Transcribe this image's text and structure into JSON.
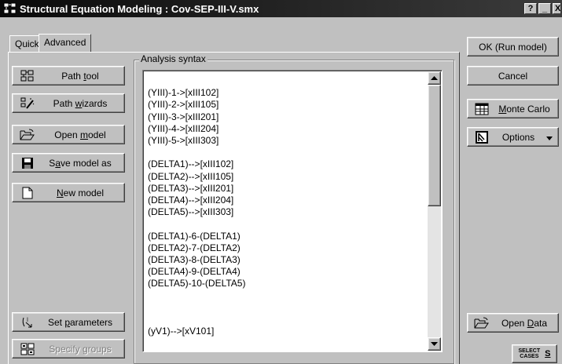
{
  "window": {
    "title": "Structural Equation Modeling : Cov-SEP-III-V.smx",
    "controls": [
      "?",
      "_",
      "X"
    ]
  },
  "tabs": [
    {
      "label": "Quick",
      "active": false
    },
    {
      "label": "Advanced",
      "active": true
    }
  ],
  "left_buttons": [
    {
      "pre": "Path ",
      "key": "t",
      "post": "ool",
      "icon": "path-tool-icon"
    },
    {
      "pre": "Path ",
      "key": "w",
      "post": "izards",
      "icon": "wand-icon"
    },
    {
      "pre": "Open ",
      "key": "m",
      "post": "odel",
      "icon": "open-folder-icon"
    },
    {
      "pre": "S",
      "key": "a",
      "post": "ve model as",
      "icon": "floppy-disk-icon"
    },
    {
      "pre": "",
      "key": "N",
      "post": "ew model",
      "icon": "new-document-icon"
    },
    {
      "pre": "Set ",
      "key": "p",
      "post": "arameters",
      "icon": "parameters-icon"
    },
    {
      "pre": "Specify ",
      "key": "g",
      "post": "roups",
      "icon": "groups-icon",
      "disabled": true
    }
  ],
  "analysis": {
    "label": "Analysis syntax",
    "lines": [
      "",
      "(YIII)-1->[xIII102]",
      "(YIII)-2->[xIII105]",
      "(YIII)-3->[xIII201]",
      "(YIII)-4->[xIII204]",
      "(YIII)-5->[xIII303]",
      "",
      "(DELTA1)-->[xIII102]",
      "(DELTA2)-->[xIII105]",
      "(DELTA3)-->[xIII201]",
      "(DELTA4)-->[xIII204]",
      "(DELTA5)-->[xIII303]",
      "",
      "(DELTA1)-6-(DELTA1)",
      "(DELTA2)-7-(DELTA2)",
      "(DELTA3)-8-(DELTA3)",
      "(DELTA4)-9-(DELTA4)",
      "(DELTA5)-10-(DELTA5)",
      "",
      "",
      "",
      "(yV1)-->[xV101]"
    ]
  },
  "right_buttons": {
    "ok": "OK (Run model)",
    "cancel": "Cancel",
    "monte_carlo": {
      "pre": "",
      "key": "M",
      "post": "onte Carlo"
    },
    "options": "Options",
    "open_data": {
      "pre": "Open ",
      "key": "D",
      "post": "ata"
    },
    "select_cases": {
      "line1": "SELECT",
      "line2": "CASES",
      "glyph": "S"
    }
  }
}
